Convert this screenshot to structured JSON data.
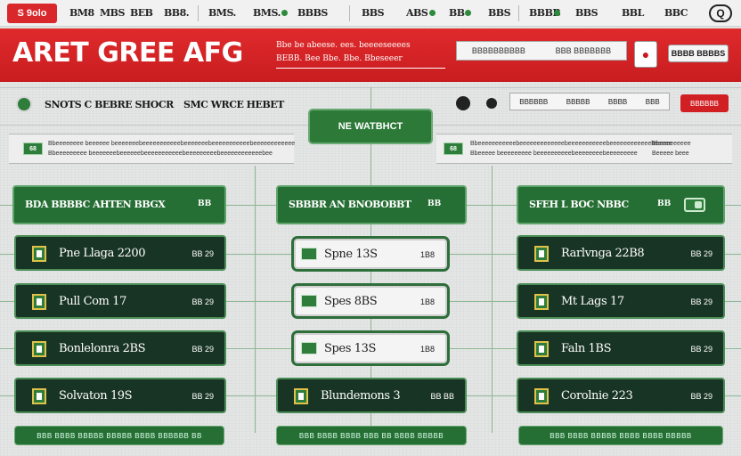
{
  "topnav": {
    "brand": "S 9olo",
    "items": [
      "BM8",
      "MBS",
      "BEB",
      "BB8.",
      "BMS.",
      "BMS.",
      "BBBS",
      "BBS",
      "ABS",
      "BB",
      "BBS",
      "BBBB",
      "BBS",
      "BBL",
      "BBC"
    ],
    "user_icon_label": "Q"
  },
  "banner": {
    "title": "ARET GREE AFG",
    "sub_line1": "Bbe be abeese. ees. beeeeseeees",
    "sub_line2": "BEBB. Bee Bbe. Bbe. Bbeseeer",
    "search_text1": "BBBBBBBBBB",
    "search_text2": "BBB BBBBBBB",
    "action_label": "BBBB BBBBS"
  },
  "toolbar": {
    "left_text1": "SNOTS C BEBRE SHOCR",
    "left_text2": "SMC WRCE HEBET",
    "center_tab": "NE WATBHCT",
    "tool_items": [
      "BBBBBB",
      "BBBBB",
      "BBBB",
      "BBB"
    ],
    "red_button": "BBBBBB"
  },
  "strips": [
    {
      "tag": "68",
      "line1": "Bbeeeeeeee beeeeee beeeeeeebeeeeeeeeeeebeeeeeeebeeeeeeeeeeebeeeeeeeeeeee",
      "line2": "Bbeeeeeeeee beeeeeeebeeeeeebeeeeeeeeeeebeeeeeeeeebeeeeeeeeeeeebee"
    },
    {
      "tag": "68",
      "line1": "Bbeeeeeeeeeeebeeeeeeeeeeeeebeeeeeeeeeeebeeeeeeeeeeeebeeeee",
      "line2": "Bbeeeee beeeeeeeee beeeeeeeeeebeeeeeeeebeeeeeeeee",
      "right1": "Bbeeeeeeeee",
      "right2": "Beeeee beee"
    }
  ],
  "columns": [
    {
      "header": "BDA BBBBC    AHTEN BBGX",
      "header_count": "BB",
      "rows": [
        {
          "name": "Pne Llaga 2200",
          "meta": "BB 29"
        },
        {
          "name": "Pull Com 17",
          "meta": "BB 29"
        },
        {
          "name": "Bonlelonra 2BS",
          "meta": "BB 29"
        },
        {
          "name": "Solvaton 19S",
          "meta": "BB 29"
        }
      ],
      "footer": "BBB BBBB BBBBB BBBBB BBBB BBBBBB BB"
    },
    {
      "header": "SBBBR AN BNOBOBBT",
      "header_count": "BB",
      "rows": [
        {
          "name": "Spne 13S",
          "meta": "1B8"
        },
        {
          "name": "Spes 8BS",
          "meta": "1B8"
        },
        {
          "name": "Spes 13S",
          "meta": "1B8"
        },
        {
          "name": "Blundemons 3",
          "meta": "BB BB"
        }
      ],
      "footer": "BBB BBBB BBBB BBB BB BBBB BBBBB"
    },
    {
      "header": "SFEH L BOC NBBC",
      "header_count": "BB",
      "rows": [
        {
          "name": "Rarlvnga 22B8",
          "meta": "BB 29"
        },
        {
          "name": "Mt Lags 17",
          "meta": "BB 29"
        },
        {
          "name": "Faln 1BS",
          "meta": "BB 29"
        },
        {
          "name": "Corolnie 223",
          "meta": "BB 29"
        }
      ],
      "footer": "BBB BBBB BBBBB BBBB BBBB BBBBB"
    }
  ],
  "colors": {
    "brand_red": "#d9282b",
    "dark_green": "#183424",
    "accent_green": "#2e7d3a"
  }
}
